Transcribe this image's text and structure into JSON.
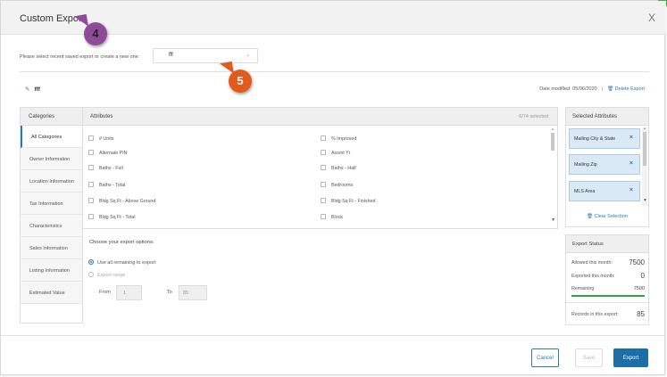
{
  "dialog": {
    "title": "Custom Export",
    "close": "X"
  },
  "saved": {
    "prompt": "Please select recent saved export or create a new one:",
    "selected": "fff"
  },
  "export": {
    "name": "fff",
    "date_modified": "Date modified: 05/06/2020",
    "separator": "|",
    "delete_label": "Delete Export"
  },
  "categories": {
    "header": "Categories",
    "items": [
      "All Categories",
      "Owner Information",
      "Location Information",
      "Tax Information",
      "Characteristics",
      "Sales Information",
      "Listing Information",
      "Estimated Value"
    ]
  },
  "attributes": {
    "header": "Attributes",
    "count": "6/74 selected",
    "left": [
      "# Units",
      "Alternate PIN",
      "Baths - Full",
      "Baths - Total",
      "Bldg Sq Ft - Above Ground",
      "Bldg Sq Ft - Total"
    ],
    "right": [
      "% Improved",
      "Assmt Yr",
      "Baths - Half",
      "Bedrooms",
      "Bldg Sq Ft - Finished",
      "Block"
    ]
  },
  "options": {
    "title": "Choose your export options:",
    "use_all": "Use all remaining to export",
    "range": "Export range",
    "from_label": "From",
    "from_value": "1",
    "to_label": "To",
    "to_value": "85"
  },
  "selected": {
    "header": "Selected Attributes",
    "items": [
      "Mailing City & State",
      "Mailing Zip",
      "MLS Area"
    ],
    "clear": "Clear Selection"
  },
  "status": {
    "header": "Export Status",
    "allowed_label": "Allowed this month:",
    "allowed_value": "7500",
    "exported_label": "Exported this month:",
    "exported_value": "0",
    "remaining_label": "Remaining",
    "remaining_value": "7500",
    "remaining_fraction": 1.0,
    "records_label": "Records in this export:",
    "records_value": "85"
  },
  "footer": {
    "cancel": "Cancel",
    "save": "Save",
    "export": "Export"
  },
  "callouts": {
    "step4": "4",
    "step5": "5"
  },
  "colors": {
    "accent": "#1b6ea8",
    "chip_bg": "#d9eaf6",
    "progress": "#3aa14a",
    "badge4": "#8e4b9a",
    "badge5": "#e25a1c"
  }
}
